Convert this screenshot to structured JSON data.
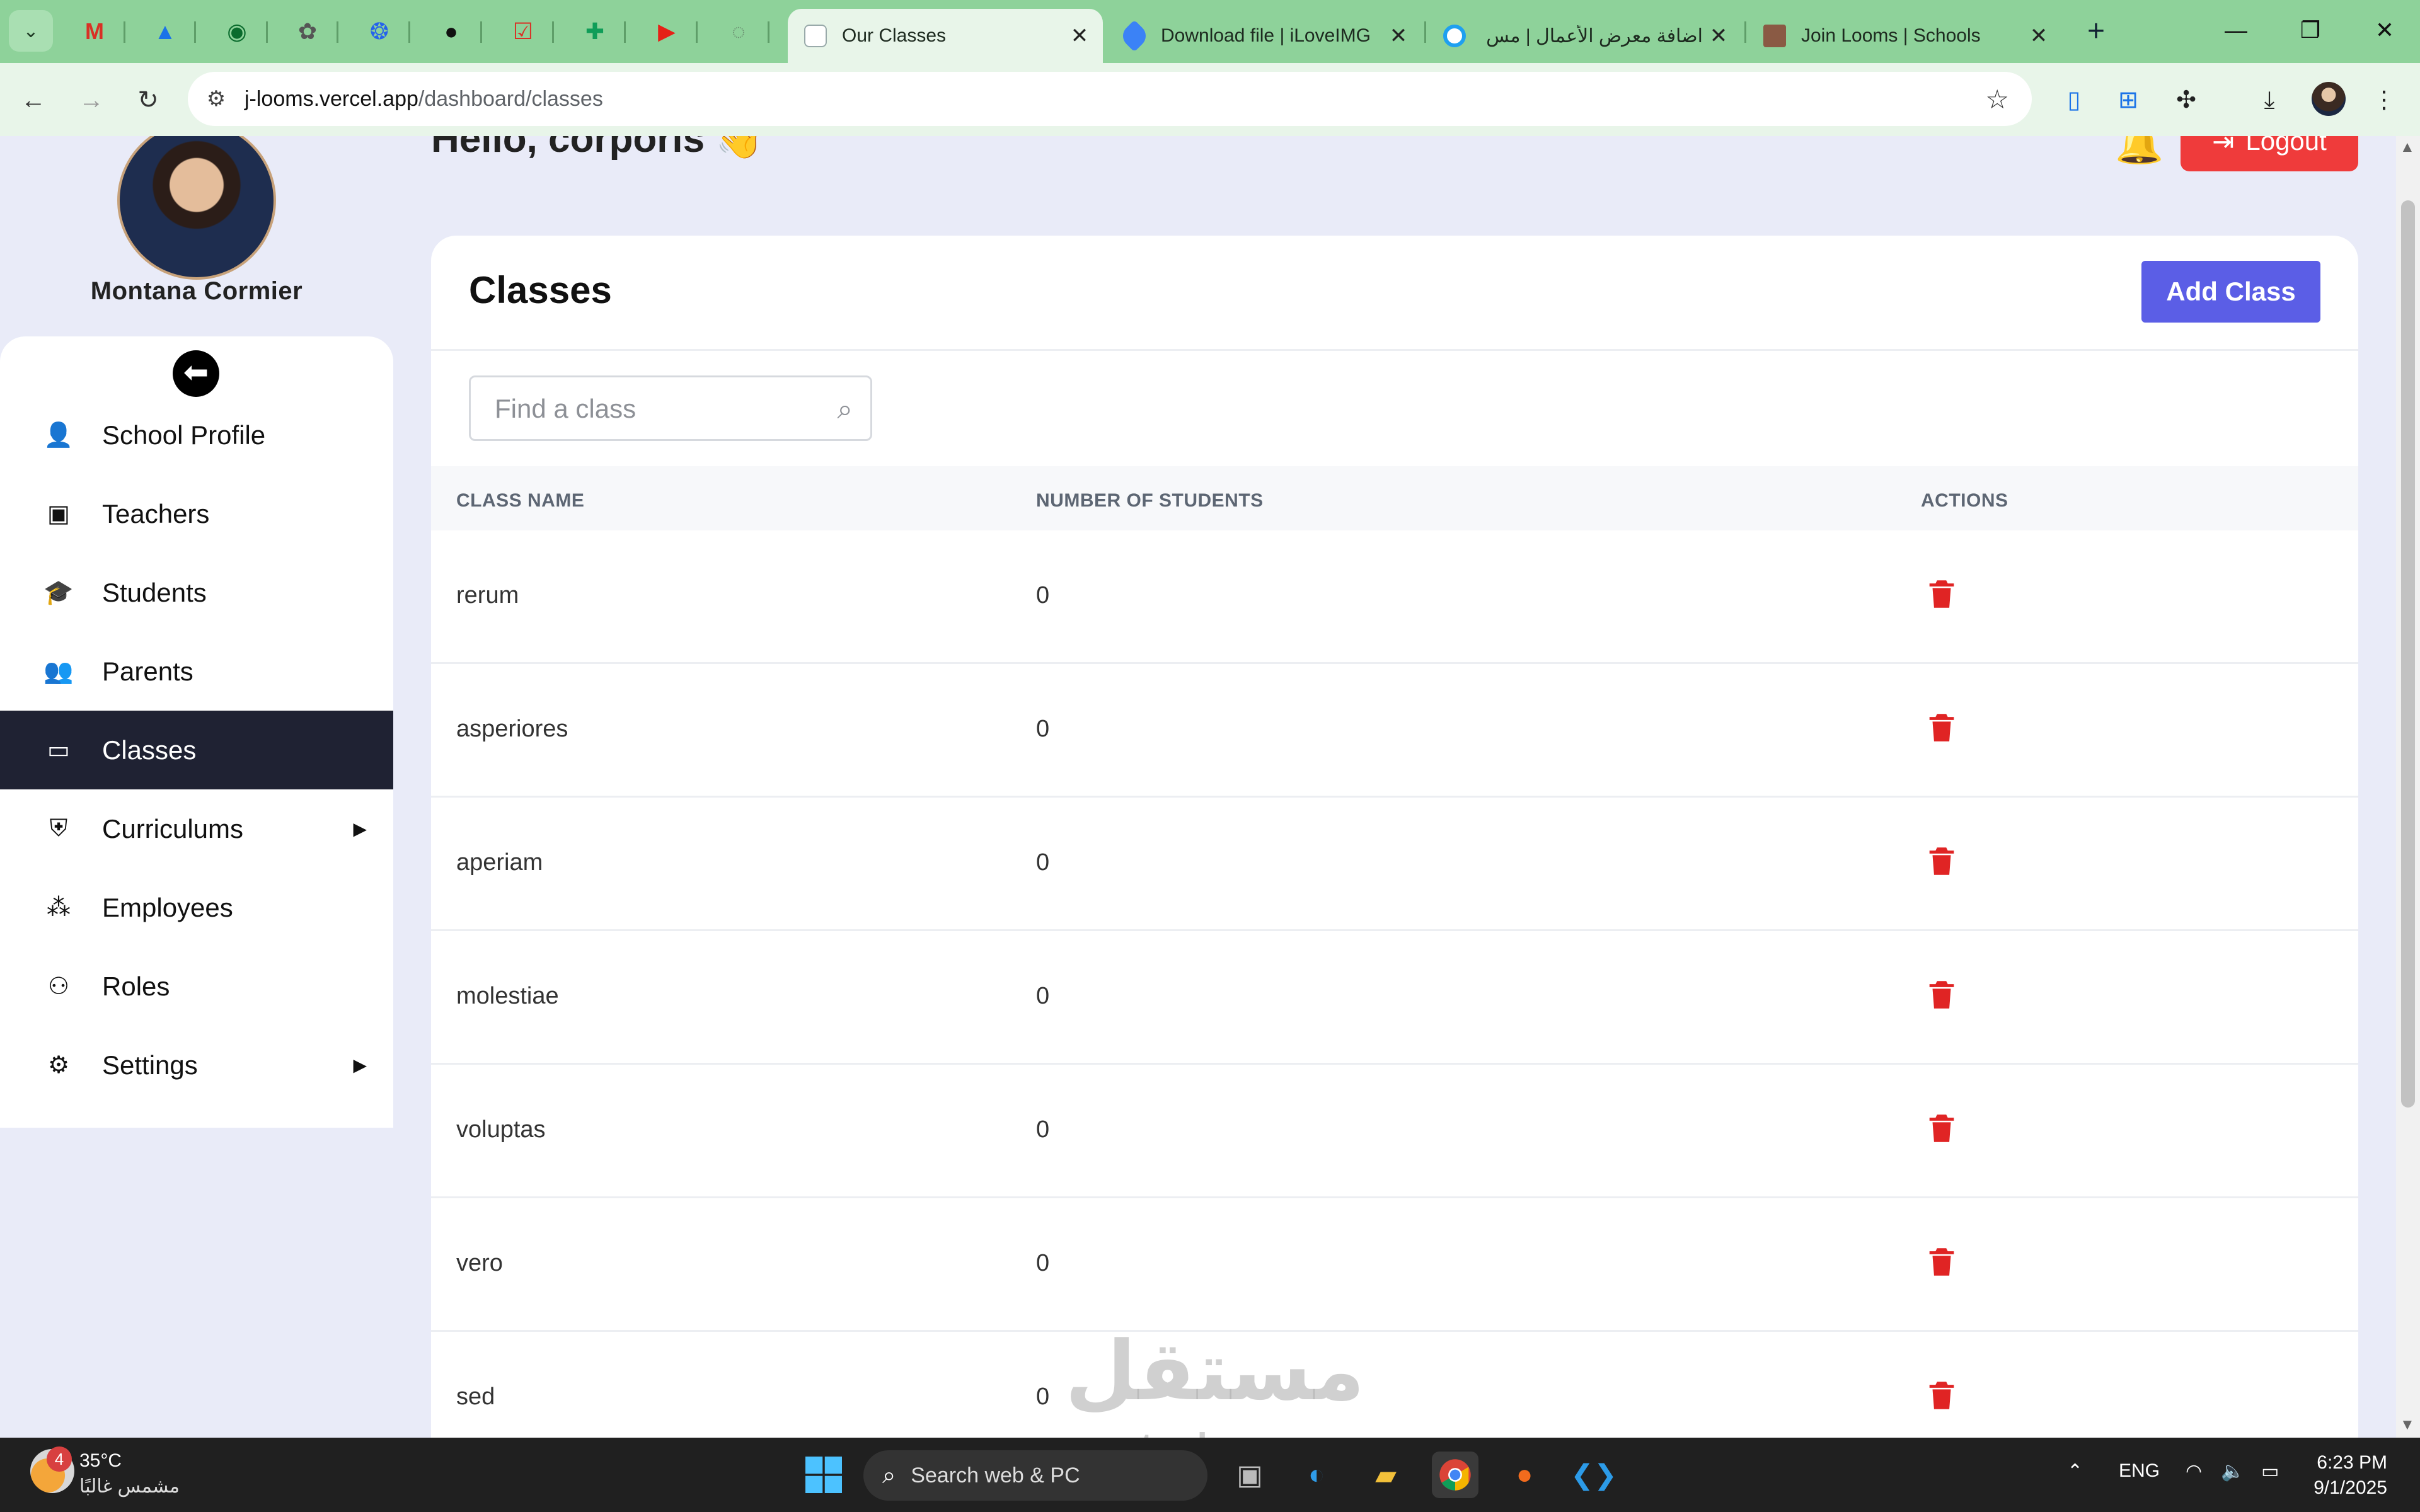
{
  "browser": {
    "tabs": [
      {
        "title": "Our Classes",
        "active": true
      },
      {
        "title": "Download file | iLoveIMG",
        "active": false
      },
      {
        "title": "اضافة معرض الأعمال | مس",
        "active": false
      },
      {
        "title": "Join Looms | Schools",
        "active": false
      }
    ],
    "pinned_icons": [
      "gmail-icon",
      "drive-icon",
      "whatsapp-icon",
      "chatgpt-icon",
      "copilot-icon",
      "github-icon",
      "todoist-icon",
      "sheets-icon",
      "youtube-icon",
      "app-icon"
    ],
    "url_host": "j-looms.vercel.app",
    "url_path": "/dashboard/classes"
  },
  "user": {
    "name": "Montana Cormier",
    "greeting": "Hello, corporis 👋"
  },
  "header": {
    "logout_label": "Logout"
  },
  "sidebar": {
    "items": [
      {
        "label": "School Profile",
        "icon": "user-icon",
        "active": false,
        "submenu": false
      },
      {
        "label": "Teachers",
        "icon": "teacher-icon",
        "active": false,
        "submenu": false
      },
      {
        "label": "Students",
        "icon": "student-icon",
        "active": false,
        "submenu": false
      },
      {
        "label": "Parents",
        "icon": "parents-icon",
        "active": false,
        "submenu": false
      },
      {
        "label": "Classes",
        "icon": "classroom-icon",
        "active": true,
        "submenu": false
      },
      {
        "label": "Curriculums",
        "icon": "shield-icon",
        "active": false,
        "submenu": true
      },
      {
        "label": "Employees",
        "icon": "people-icon",
        "active": false,
        "submenu": false
      },
      {
        "label": "Roles",
        "icon": "user-cog-icon",
        "active": false,
        "submenu": false
      },
      {
        "label": "Settings",
        "icon": "gear-icon",
        "active": false,
        "submenu": true
      }
    ]
  },
  "main": {
    "title": "Classes",
    "add_button": "Add Class",
    "search_placeholder": "Find a class",
    "columns": [
      "CLASS NAME",
      "NUMBER OF STUDENTS",
      "ACTIONS"
    ],
    "rows": [
      {
        "name": "rerum",
        "students": "0"
      },
      {
        "name": "asperiores",
        "students": "0"
      },
      {
        "name": "aperiam",
        "students": "0"
      },
      {
        "name": "molestiae",
        "students": "0"
      },
      {
        "name": "voluptas",
        "students": "0"
      },
      {
        "name": "vero",
        "students": "0"
      },
      {
        "name": "sed",
        "students": "0"
      }
    ]
  },
  "watermark": {
    "text": "مستقل",
    "sub": "mostaql.com"
  },
  "taskbar": {
    "weather_badge": "4",
    "temperature": "35°C",
    "condition": "مشمس غالبًا",
    "search_label": "Search web & PC",
    "language": "ENG",
    "time": "6:23 PM",
    "date": "9/1/2025"
  },
  "colors": {
    "accent": "#5b5ee6",
    "danger": "#e02424",
    "active_nav": "#1f2233",
    "page_bg": "#e9ebf8",
    "tabstrip": "#8ed29a"
  }
}
